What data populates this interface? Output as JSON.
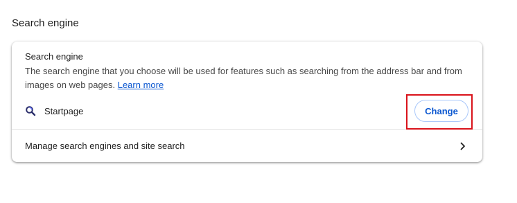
{
  "section": {
    "title": "Search engine"
  },
  "card": {
    "heading": "Search engine",
    "description": "The search engine that you choose will be used for features such as searching from the address bar and from images on web pages.",
    "learn_more": "Learn more",
    "engine": {
      "name": "Startpage",
      "icon": "startpage-magnifier-icon"
    },
    "change_label": "Change",
    "manage_label": "Manage search engines and site search",
    "manage_icon": "chevron-right-icon"
  },
  "colors": {
    "accent": "#0b57d0",
    "button_border": "#a8c7fa",
    "highlight": "#d9121a"
  }
}
